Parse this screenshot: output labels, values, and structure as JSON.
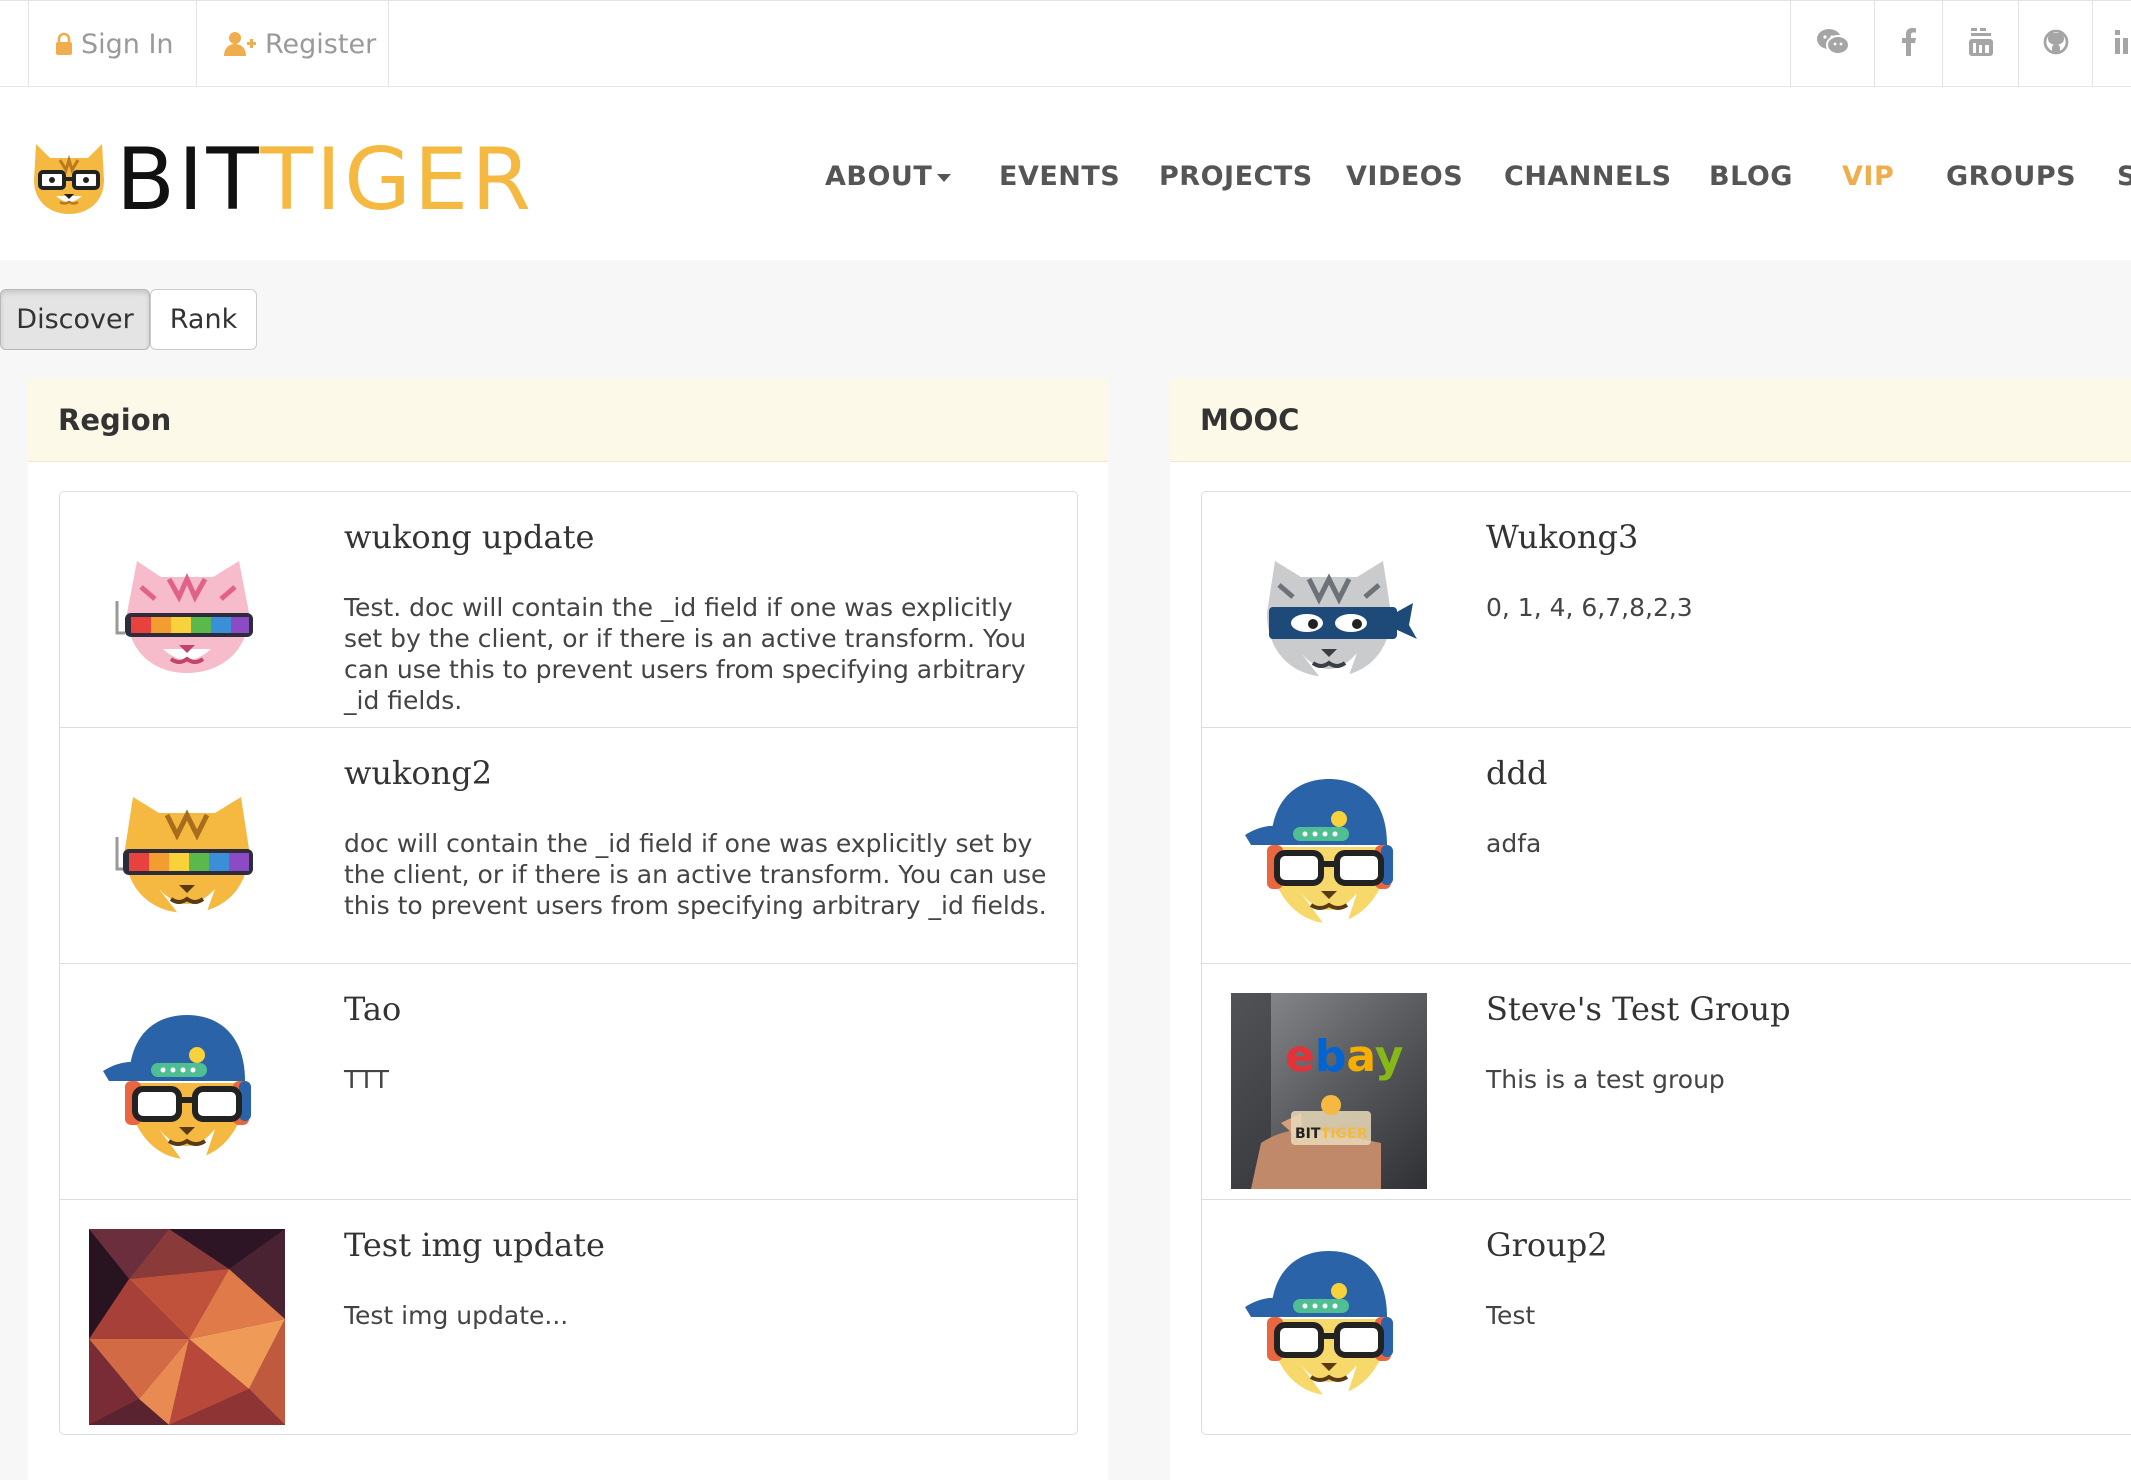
{
  "topbar": {
    "signin_label": "Sign In",
    "register_label": "Register",
    "social": [
      {
        "icon": "wechat-icon"
      },
      {
        "icon": "facebook-icon"
      },
      {
        "icon": "youtube-icon"
      },
      {
        "icon": "github-icon"
      },
      {
        "icon": "linkedin-icon"
      }
    ]
  },
  "logo": {
    "part1": "BIT",
    "part2": "TIGER"
  },
  "nav": {
    "items": [
      "ABOUT",
      "EVENTS",
      "PROJECTS",
      "VIDEOS",
      "CHANNELS",
      "BLOG",
      "VIP",
      "GROUPS",
      "S"
    ]
  },
  "tabs": {
    "discover": "Discover",
    "rank": "Rank"
  },
  "colors": {
    "accent": "#f0ad4e",
    "panel_header": "#fdf9e8"
  },
  "panels": [
    {
      "heading": "Region",
      "groups": [
        {
          "title": "wukong update",
          "description": "Test. doc will contain the _id field if one was explicitly set by the client, or if there is an active transform. You can use this to prevent users from specifying arbitrary _id fields.",
          "avatar": "pink-tiger-rainbow-glasses"
        },
        {
          "title": "wukong2",
          "description": "doc will contain the _id field if one was explicitly set by the client, or if there is an active transform. You can use this to prevent users from specifying arbitrary _id fields.",
          "avatar": "orange-tiger-rainbow-glasses"
        },
        {
          "title": "Tao",
          "description": "TTT",
          "avatar": "orange-tiger-cap-glasses"
        },
        {
          "title": "Test img update",
          "description": "Test img update...",
          "avatar": "polygon-abstract-image"
        }
      ]
    },
    {
      "heading": "MOOC",
      "groups": [
        {
          "title": "Wukong3",
          "description": "0, 1, 4, 6,7,8,2,3",
          "avatar": "grey-tiger-ninja-mask"
        },
        {
          "title": "ddd",
          "description": "adfa",
          "avatar": "yellow-tiger-cap-glasses"
        },
        {
          "title": "Steve's Test Group",
          "description": "This is a test group",
          "avatar": "ebay-photo",
          "photo_text": [
            "ebay",
            "BIT",
            "TIGER"
          ]
        },
        {
          "title": "Group2",
          "description": "Test",
          "avatar": "yellow-tiger-cap-glasses"
        }
      ]
    }
  ]
}
